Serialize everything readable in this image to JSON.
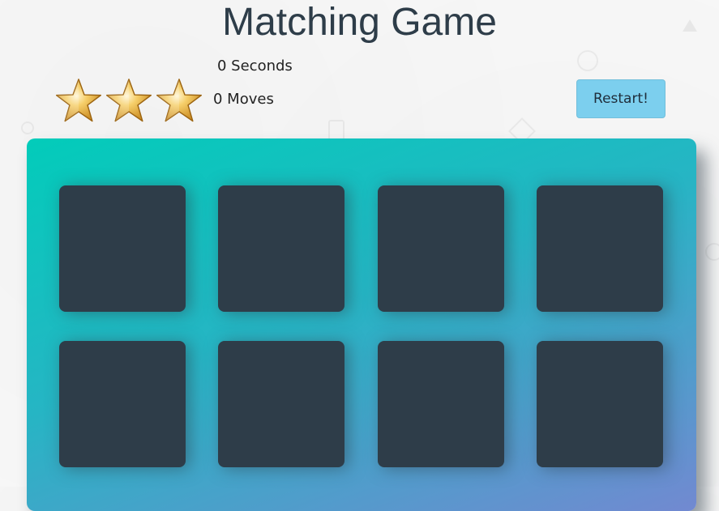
{
  "header": {
    "title": "Matching Game"
  },
  "score_panel": {
    "timer_text": "0 Seconds",
    "moves_text": "0 Moves",
    "stars": [
      "star-icon",
      "star-icon",
      "star-icon"
    ],
    "restart_label": "Restart!"
  },
  "deck": {
    "cards": [
      {
        "state": "face-down"
      },
      {
        "state": "face-down"
      },
      {
        "state": "face-down"
      },
      {
        "state": "face-down"
      },
      {
        "state": "face-down"
      },
      {
        "state": "face-down"
      },
      {
        "state": "face-down"
      },
      {
        "state": "face-down"
      }
    ]
  },
  "colors": {
    "card_back": "#2e3d49",
    "deck_gradient_start": "#02ccba",
    "deck_gradient_end": "#7289d1",
    "restart_button": "#7ccfee",
    "star_gold": "#f2b233"
  }
}
